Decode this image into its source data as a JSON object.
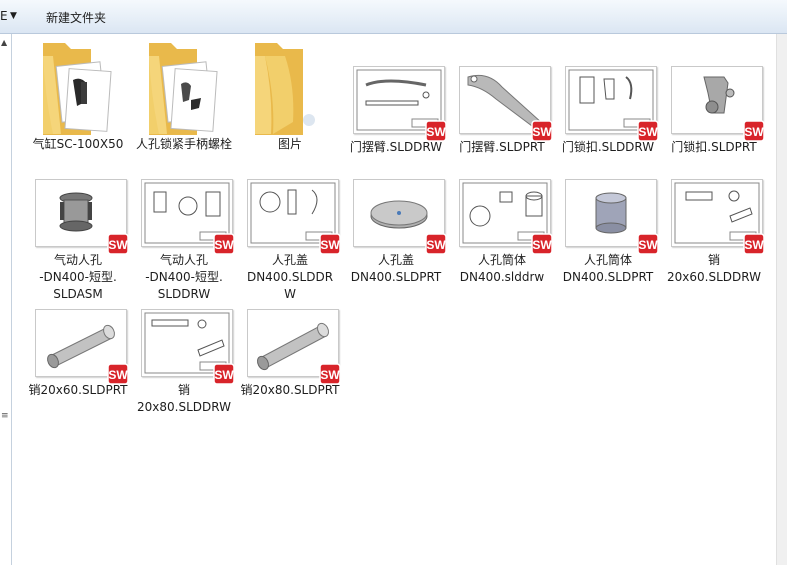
{
  "toolbar": {
    "truncated_label": "E",
    "new_folder_label": "新建文件夹"
  },
  "items": [
    {
      "name": "气缸SC-100X50",
      "type": "folder"
    },
    {
      "name": "人孔锁紧手柄螺栓",
      "type": "folder"
    },
    {
      "name": "图片",
      "type": "folder"
    },
    {
      "name": "门摆臂.SLDDRW",
      "type": "drawing"
    },
    {
      "name": "门摆臂.SLDPRT",
      "type": "part"
    },
    {
      "name": "门锁扣.SLDDRW",
      "type": "drawing"
    },
    {
      "name": "门锁扣.SLDPRT",
      "type": "part"
    },
    {
      "name": "气动人孔\n-DN400-短型.\nSLDASM",
      "type": "assembly"
    },
    {
      "name": "气动人孔\n-DN400-短型.\nSLDDRW",
      "type": "drawing"
    },
    {
      "name": "人孔盖\nDN400.SLDDR\nW",
      "type": "drawing"
    },
    {
      "name": "人孔盖\nDN400.SLDPRT",
      "type": "part"
    },
    {
      "name": "人孔筒体\nDN400.slddrw",
      "type": "drawing"
    },
    {
      "name": "人孔筒体\nDN400.SLDPRT",
      "type": "part"
    },
    {
      "name": "销\n20x60.SLDDRW",
      "type": "drawing"
    },
    {
      "name": "销20x60.SLDPRT",
      "type": "part"
    },
    {
      "name": "销\n20x80.SLDDRW",
      "type": "drawing"
    },
    {
      "name": "销20x80.SLDPRT",
      "type": "part"
    }
  ],
  "icons": {
    "folder": "folder-icon",
    "solidworks_badge": "solidworks-icon"
  },
  "colors": {
    "solidworks_red": "#d8242a",
    "folder_yellow": "#f2cf6b",
    "selection_blue": "#cde8ff"
  }
}
